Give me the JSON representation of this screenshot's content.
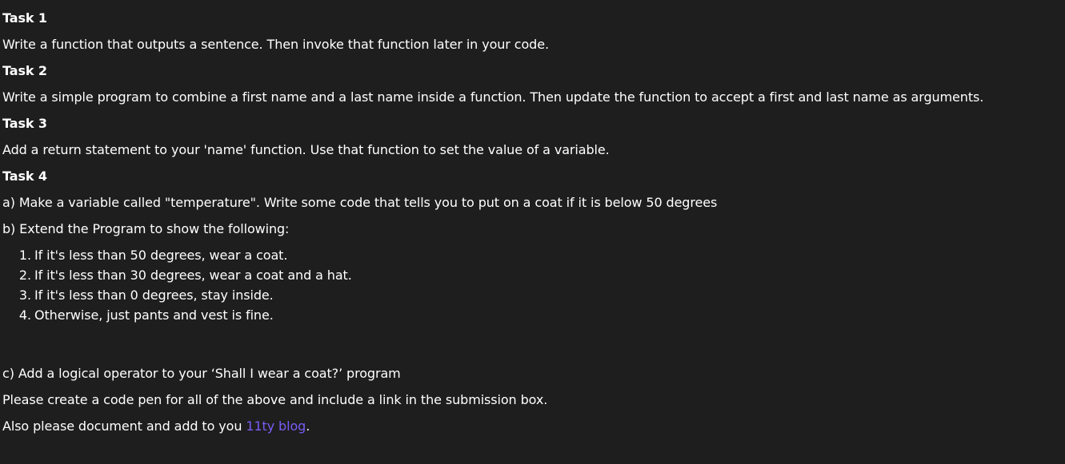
{
  "task1": {
    "heading": "Task 1",
    "text": "Write a function that outputs a sentence. Then invoke that function later in your code."
  },
  "task2": {
    "heading": "Task 2",
    "text": "Write a simple program to combine a first name and a last name inside a function. Then update the function to accept a first and last name as arguments."
  },
  "task3": {
    "heading": "Task 3",
    "text": "Add a return statement to your 'name' function. Use that function to set the value of a variable."
  },
  "task4": {
    "heading": "Task 4",
    "part_a": "a) Make a variable called \"temperature\". Write some code that tells you to put on a coat if it is below 50 degrees",
    "part_b": "b) Extend the Program to show the following:",
    "list": [
      {
        "num": "1.",
        "text": "If it's less than 50 degrees, wear a coat."
      },
      {
        "num": "2.",
        "text": "If it's less than 30 degrees, wear a coat and a hat."
      },
      {
        "num": "3.",
        "text": "If it's less than 0 degrees, stay inside."
      },
      {
        "num": "4.",
        "text": "Otherwise, just pants and vest is fine."
      }
    ],
    "part_c": "c) Add a logical operator to your ‘Shall I wear a coat?’ program"
  },
  "footer": {
    "codepen_text": "Please create a code pen for all of the above and include a link in the submission box.",
    "blog_prefix": "Also please document and add to you ",
    "blog_link": "11ty blog",
    "blog_suffix": "."
  }
}
